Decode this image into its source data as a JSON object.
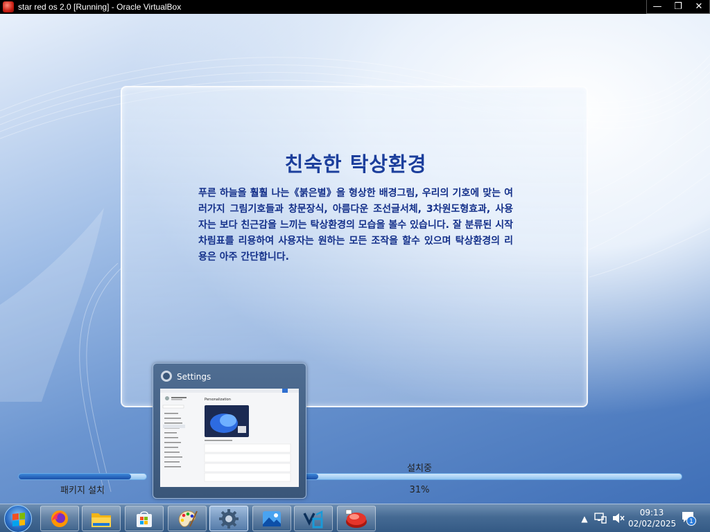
{
  "host_window": {
    "title": "star red os 2.0 [Running] - Oracle VirtualBox",
    "controls": {
      "minimize": "—",
      "restore": "❐",
      "close": "✕"
    }
  },
  "installer": {
    "title": "친숙한 탁상환경",
    "body": "푸른 하늘을 훨훨 나는《붉은별》을 형상한 배경그림, 우리의 기호에 맞는 여러가지 그림기호들과 창문장식, 아름다운 조선글서체, 3차원도형효과, 사용자는 보다 친근감을 느끼는 탁상환경의 모습을 볼수 있습니다. 잘 분류된 시작차림표를 리용하여 사용자는 원하는 모든 조작을 할수 있으며 탁상환경의 리용은 아주 간단합니다.",
    "package_label": "패키지 설치",
    "package_progress": 0.88,
    "status_label": "설치중",
    "overall_percent_text": "31%",
    "overall_progress": 0.31
  },
  "thumbnail": {
    "title": "Settings",
    "preview_heading": "Personalization"
  },
  "taskbar": {
    "apps": [
      {
        "name": "firefox"
      },
      {
        "name": "file-explorer"
      },
      {
        "name": "microsoft-store"
      },
      {
        "name": "paint"
      },
      {
        "name": "settings"
      },
      {
        "name": "photos"
      },
      {
        "name": "visual-studio"
      },
      {
        "name": "red-star"
      }
    ],
    "clock_time": "09:13",
    "clock_date": "02/02/2025",
    "notification_count": "1"
  },
  "colors": {
    "title_blue": "#1c3f9c",
    "progress_blue": "#1a4fa8",
    "taskbar": "#456a93"
  }
}
